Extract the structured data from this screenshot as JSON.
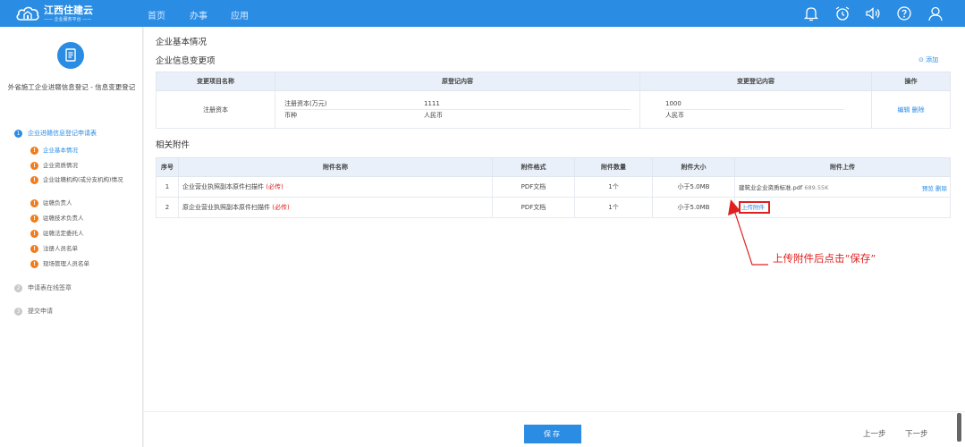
{
  "brand": {
    "title": "江西住建云",
    "subtitle": "—— 企业服务平台 ——"
  },
  "nav": {
    "items": [
      "首页",
      "办事",
      "应用"
    ]
  },
  "top_icons": [
    "bell-icon",
    "alarm-clock-icon",
    "speaker-icon",
    "help-icon",
    "user-icon"
  ],
  "sidebar": {
    "icon": "document-icon",
    "title": "外省施工企业进赣信息登记 - 信息变更登记",
    "steps": [
      {
        "num": "1",
        "label": "企业进赣信息登记申请表"
      },
      {
        "num": "2",
        "label": "申请表在线签章"
      },
      {
        "num": "3",
        "label": "提交申请"
      }
    ],
    "sub_items": [
      "企业基本情况",
      "企业资质情况",
      "企业驻赣机构(或分支机构)情况",
      "驻赣负责人",
      "驻赣技术负责人",
      "驻赣法定委托人",
      "注册人员名单",
      "现场管理人员名单"
    ]
  },
  "main": {
    "page_title": "企业基本情况",
    "change_section": "企业信息变更项",
    "add_label": "⊙ 添加",
    "change_table": {
      "headers": [
        "变更项目名称",
        "原登记内容",
        "变更登记内容",
        "操作"
      ],
      "row": {
        "item": "注册资本",
        "original": [
          {
            "label": "注册资本(万元)",
            "value": "1111"
          },
          {
            "label": "币种",
            "value": "人民币"
          }
        ],
        "changed": [
          "1000",
          "人民币"
        ],
        "edit": "编辑",
        "delete": "删除"
      }
    },
    "attach_section": "相关附件",
    "attach_table": {
      "headers": [
        "序号",
        "附件名称",
        "附件格式",
        "附件数量",
        "附件大小",
        "附件上传"
      ],
      "rows": [
        {
          "no": "1",
          "name": "企业营业执照副本原件扫描件",
          "required": "(必传)",
          "format": "PDF文档",
          "count": "1个",
          "size": "小于5.0MB",
          "file": "建筑业企业资质标准.pdf",
          "file_size": "689.55K",
          "preview": "预览",
          "delete": "删除"
        },
        {
          "no": "2",
          "name": "原企业营业执照副本原件扫描件",
          "required": "(必传)",
          "format": "PDF文档",
          "count": "1个",
          "size": "小于5.0MB",
          "upload": "上传附件"
        }
      ]
    },
    "annotation": "上传附件后点击“保存”"
  },
  "footer": {
    "save": "保存",
    "prev": "上一步",
    "next": "下一步"
  },
  "colors": {
    "primary": "#2a8ce3",
    "warning": "#f07c1c",
    "annotation": "#e02020"
  }
}
